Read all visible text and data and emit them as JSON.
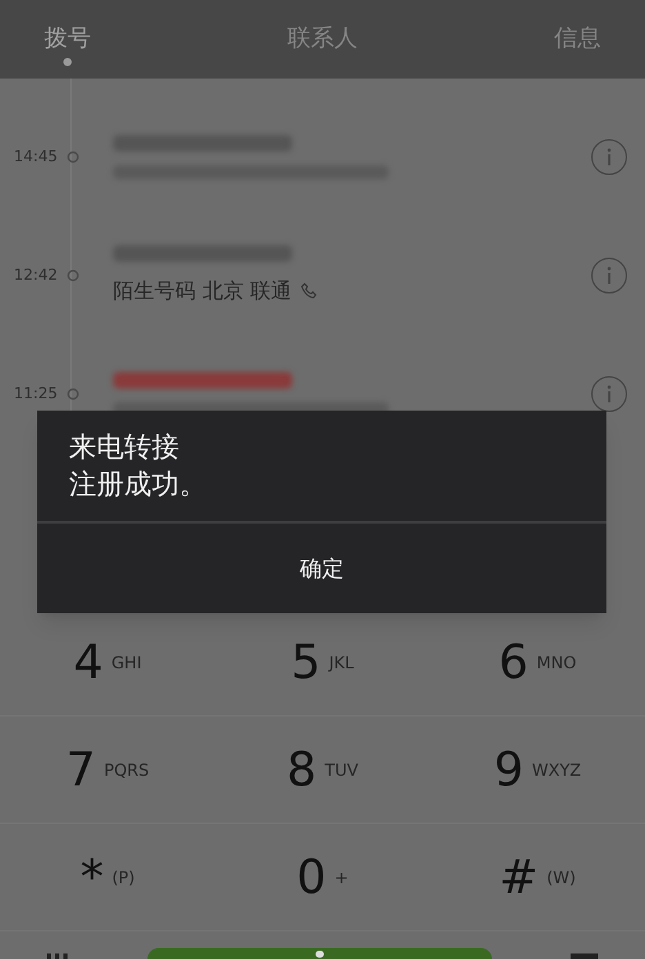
{
  "tabs": [
    {
      "label": "拨号",
      "selected": true
    },
    {
      "label": "联系人",
      "selected": false
    },
    {
      "label": "信息",
      "selected": false
    }
  ],
  "calls": [
    {
      "time": "14:45",
      "missed": false
    },
    {
      "time": "12:42",
      "detail": "陌生号码 北京 联通",
      "missed": false
    },
    {
      "time": "11:25",
      "missed": true
    }
  ],
  "dialog": {
    "message": [
      "来电转接",
      "注册成功。"
    ],
    "button": "确定"
  },
  "keys": [
    {
      "digit": "4",
      "letters": "GHI"
    },
    {
      "digit": "5",
      "letters": "JKL"
    },
    {
      "digit": "6",
      "letters": "MNO"
    },
    {
      "digit": "7",
      "letters": "PQRS"
    },
    {
      "digit": "8",
      "letters": "TUV"
    },
    {
      "digit": "9",
      "letters": "WXYZ"
    },
    {
      "digit": "*",
      "letters": "(P)"
    },
    {
      "digit": "0",
      "letters": "+"
    },
    {
      "digit": "#",
      "letters": "(W)"
    }
  ]
}
